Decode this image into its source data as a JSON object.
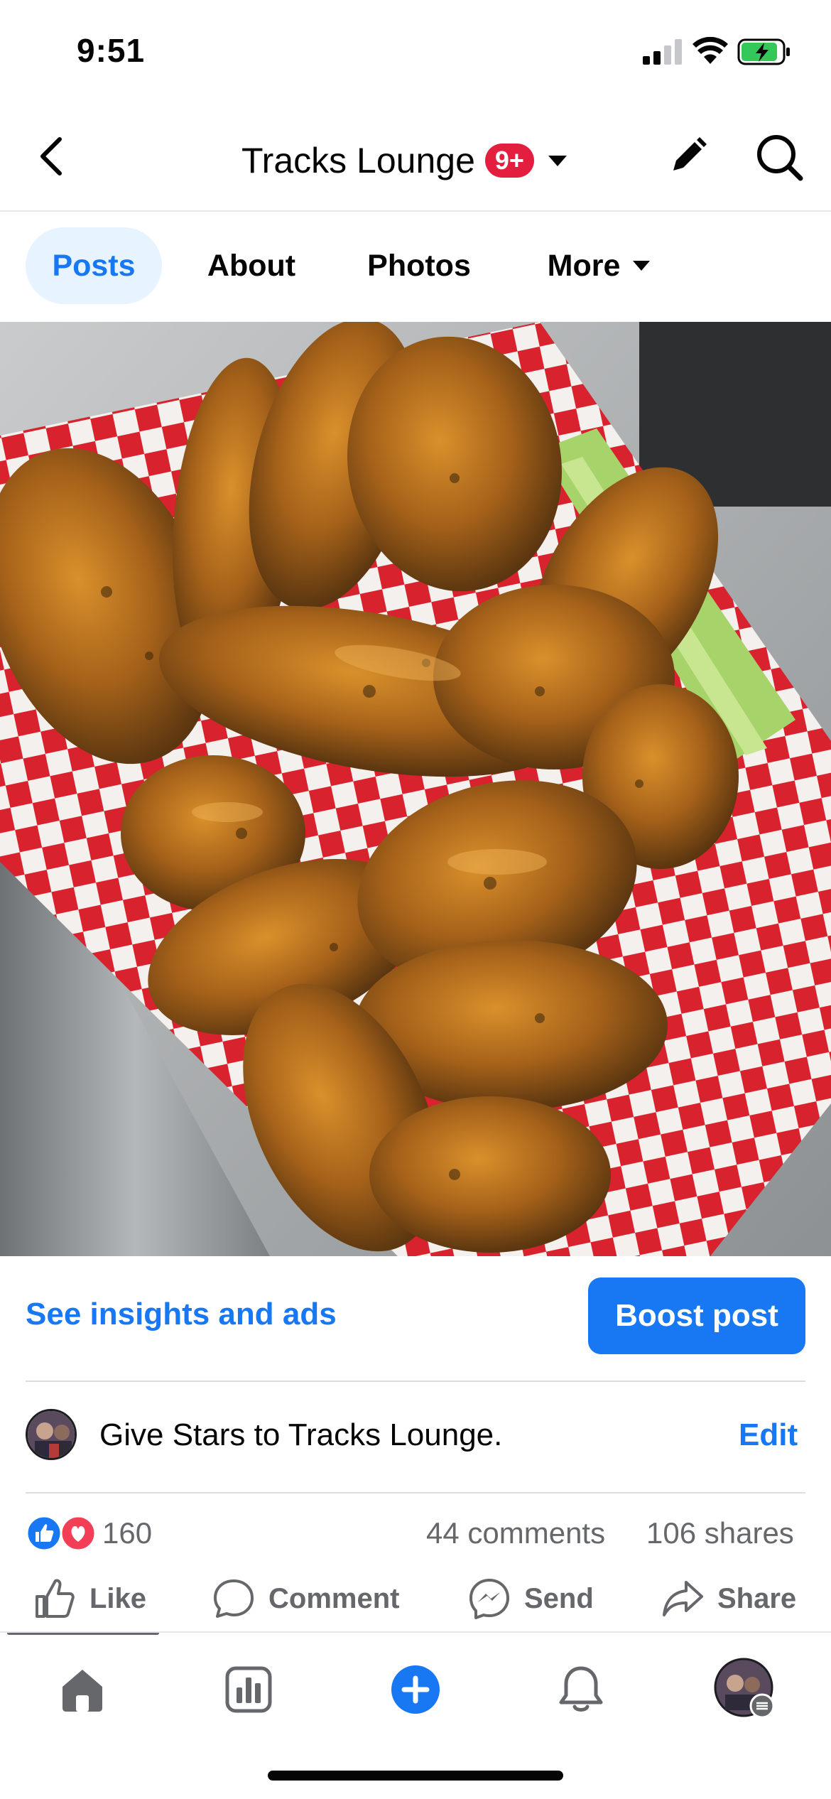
{
  "status_bar": {
    "time": "9:51"
  },
  "header": {
    "page_title": "Tracks Lounge",
    "notification_badge": "9+"
  },
  "tabs": [
    {
      "label": "Posts",
      "active": true
    },
    {
      "label": "About",
      "active": false
    },
    {
      "label": "Photos",
      "active": false
    },
    {
      "label": "More",
      "active": false
    }
  ],
  "post": {
    "insights_label": "See insights and ads",
    "boost_label": "Boost post",
    "stars_text": "Give Stars to Tracks Lounge.",
    "stars_edit_label": "Edit",
    "reaction_count": "160",
    "comments_label": "44 comments",
    "shares_label": "106 shares"
  },
  "actions": {
    "like_label": "Like",
    "comment_label": "Comment",
    "send_label": "Send",
    "share_label": "Share"
  },
  "bottom_nav": [
    "home-icon",
    "insights-icon",
    "create-icon",
    "notifications-icon",
    "profile-icon"
  ],
  "colors": {
    "accent": "#1877f2",
    "badge_red": "#e41e3f",
    "secondary_text": "#65676b",
    "active_tab_bg": "#e7f3ff"
  }
}
